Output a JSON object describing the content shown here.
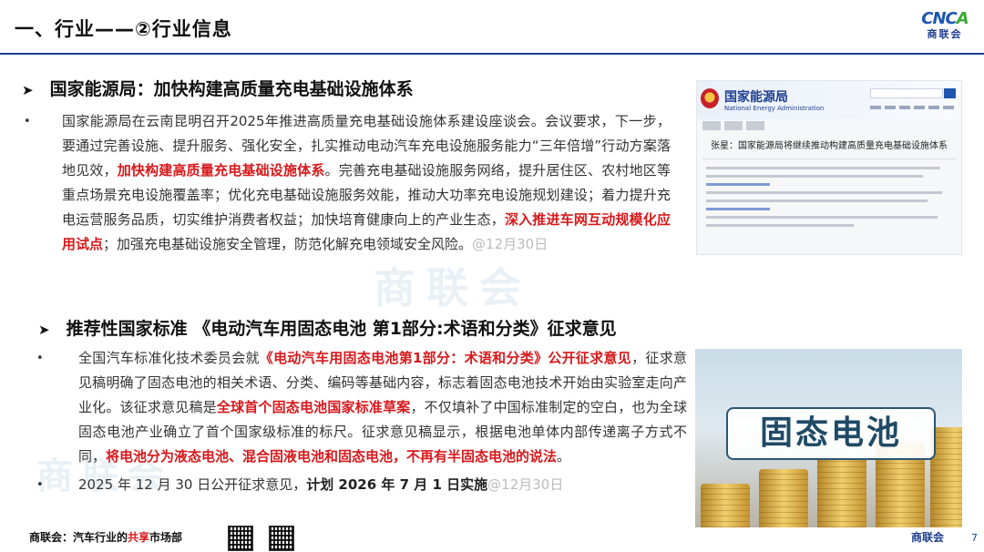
{
  "header": {
    "title": "一、行业——②行业信息",
    "logo_mark": "CNCA",
    "logo_text": "商联会"
  },
  "watermark": "商联会",
  "section1": {
    "heading": "国家能源局：加快构建高质量充电基础设施体系",
    "bullet_parts": {
      "p1": "国家能源局在云南昆明召开2025年推进高质量充电基础设施体系建设座谈会。会议要求，下一步，要通过完善设施、提升服务、强化安全，扎实推动电动汽车充电设施服务能力“三年倍增”行动方案落地见效，",
      "p2_red": "加快构建高质量充电基础设施体系",
      "p3": "。完善充电基础设施服务网络，提升居住区、农村地区等重点场景充电设施覆盖率；优化充电基础设施服务效能，推动大功率充电设施规划建设；着力提升充电运营服务品质，切实维护消费者权益；加快培育健康向上的产业生态，",
      "p4_red": "深入推进车网互动规模化应用试点",
      "p5": "；加强充电基础设施安全管理，防范化解充电领域安全风险。",
      "stamp": "@12月30日"
    },
    "image": {
      "site_name": "国家能源局",
      "site_name_en": "National Energy Administration",
      "headline": "张星：国家能源局将继续推动构建高质量充电基础设施体系"
    }
  },
  "section2": {
    "heading": "推荐性国家标准 《电动汽车用固态电池 第1部分:术语和分类》征求意见",
    "bullet1_parts": {
      "p1": "全国汽车标准化技术委员会就",
      "p2_red": "《电动汽车用固态电池第1部分：术语和分类》公开征求意见",
      "p3": "，征求意见稿明确了固态电池的相关术语、分类、编码等基础内容，标志着固态电池技术开始由实验室走向产业化。该征求意见稿是",
      "p4_red": "全球首个固态电池国家标准草案",
      "p5": "，不仅填补了中国标准制定的空白，也为全球固态电池产业确立了首个国家级标准的标尺。征求意见稿显示，根据电池单体内部传递离子方式不同，",
      "p6_red": "将电池分为液态电池、混合固液电池和固态电池，不再有半固态电池的说法",
      "p7": "。"
    },
    "bullet2_parts": {
      "p1": "2025 年 12 月 30 日公开征求意见，",
      "p2_bold": "计划 2026 年 7 月 1 日实施",
      "stamp": "@12月30日"
    },
    "image": {
      "label": "固态电池"
    }
  },
  "footer": {
    "dept_prefix": "商联会：汽车行业的",
    "dept_highlight": "共享",
    "dept_suffix": "市场部",
    "brand": "商联会",
    "page_number": "7"
  },
  "icons": {
    "section_marker": "triangle-right-icon",
    "bullet": "bullet-dot-icon",
    "qr": "qr-code-icon"
  },
  "colors": {
    "accent_blue": "#1e3f8f",
    "highlight_red": "#d7191c"
  }
}
